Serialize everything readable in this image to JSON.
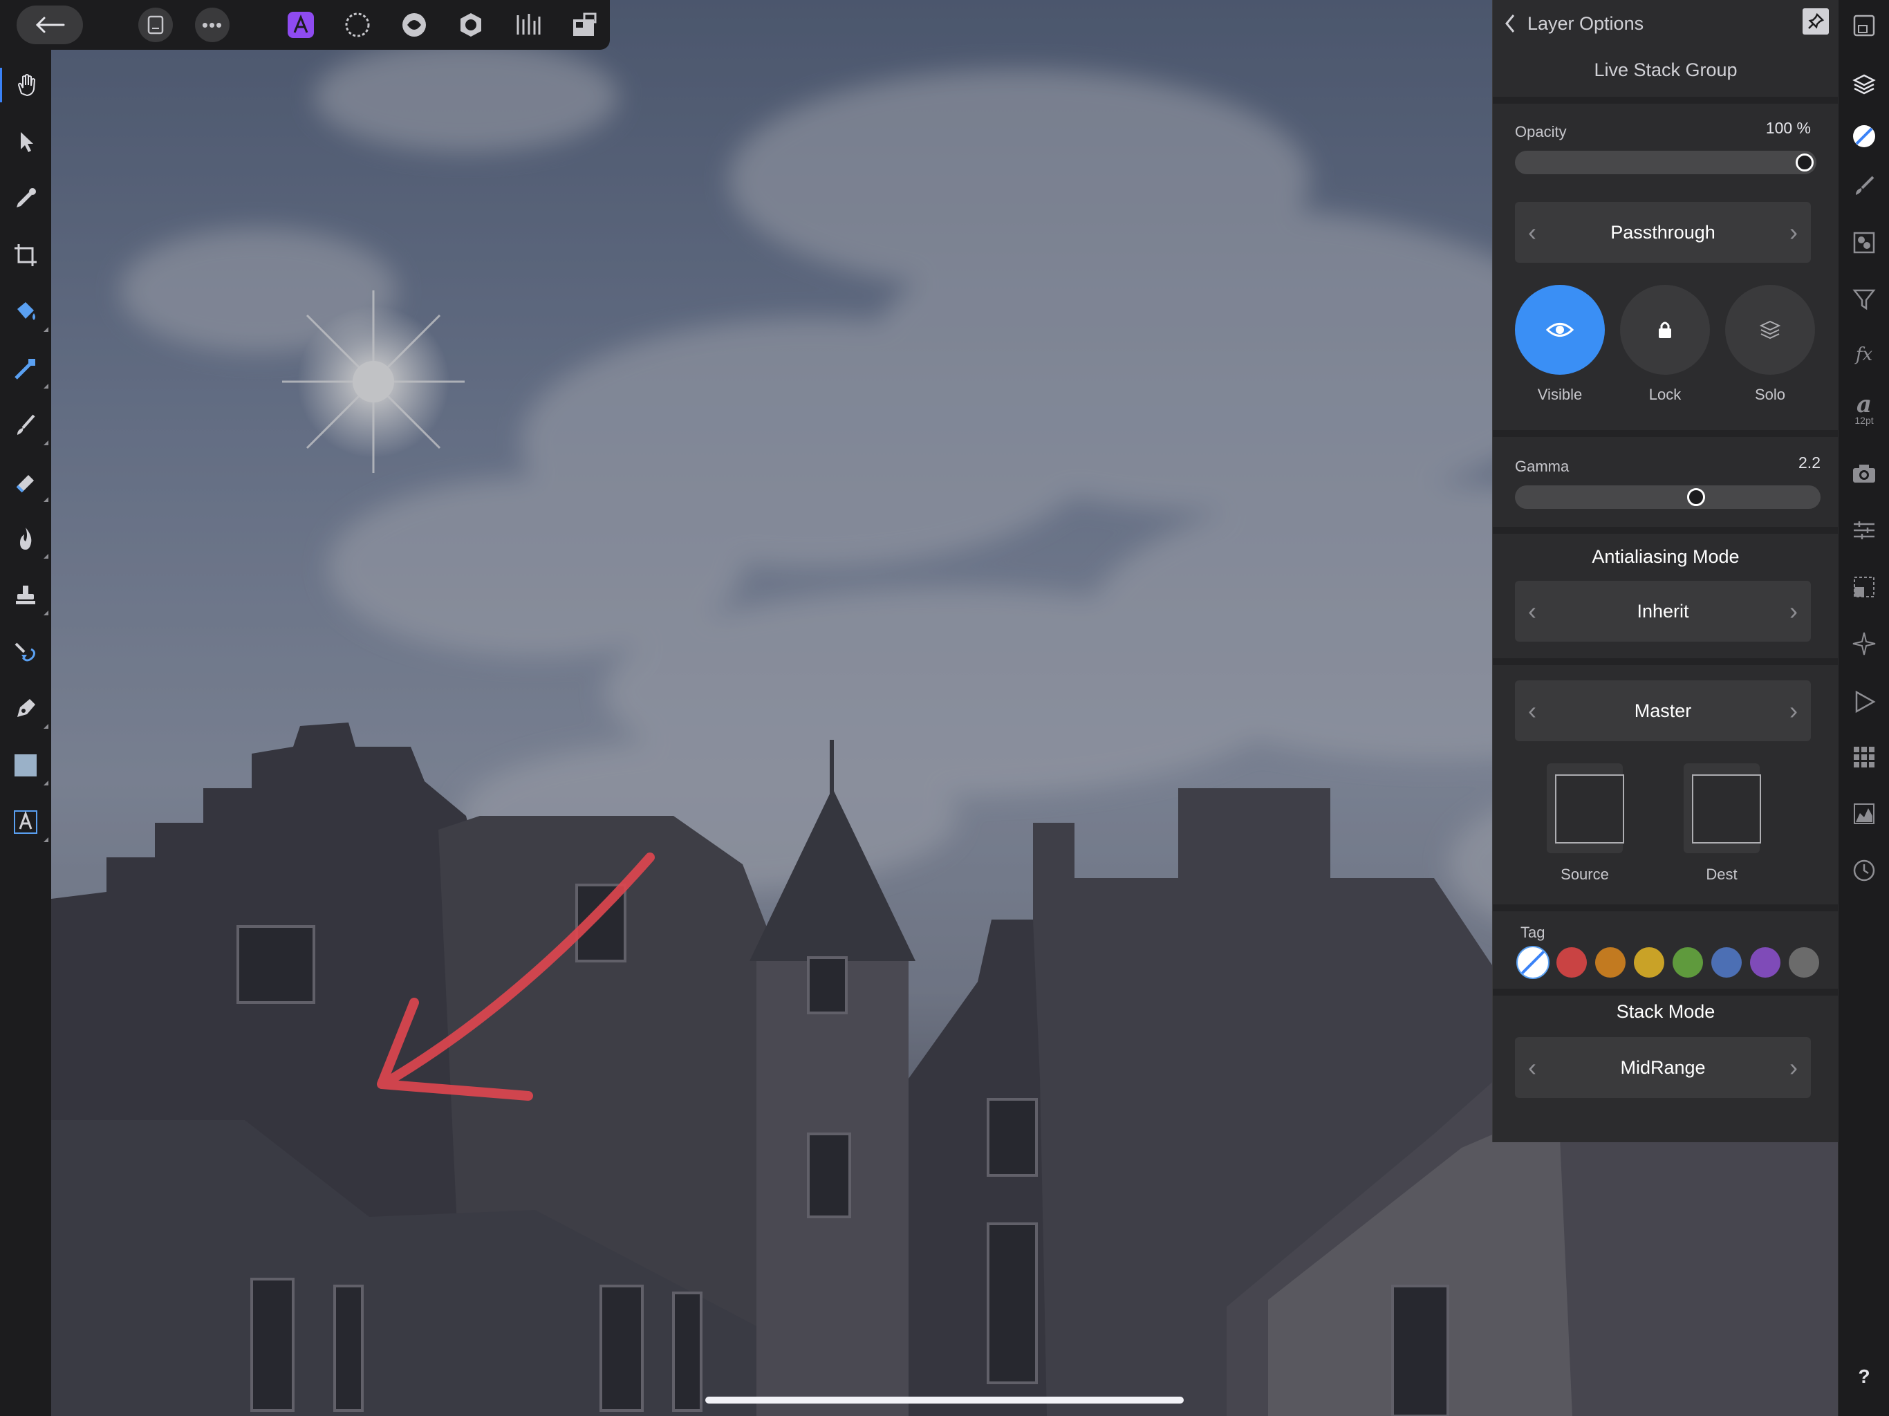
{
  "panel": {
    "back_title": "Layer Options",
    "layer_name": "Live Stack Group",
    "opacity_label": "Opacity",
    "opacity_value": "100 %",
    "opacity_level": 1.0,
    "blend_mode": "Passthrough",
    "visible_label": "Visible",
    "lock_label": "Lock",
    "solo_label": "Solo",
    "gamma_label": "Gamma",
    "gamma_value": "2.2",
    "gamma_level": 0.6,
    "antialiasing_heading": "Antialiasing Mode",
    "antialiasing_value": "Inherit",
    "channel_value": "Master",
    "source_label": "Source",
    "dest_label": "Dest",
    "tag_label": "Tag",
    "tag_colors": [
      "#c94343",
      "#c27a20",
      "#c9a227",
      "#5f9a3d",
      "#4c6fb4",
      "#7f4bb8",
      "#6b6b6b"
    ],
    "stack_mode_heading": "Stack Mode",
    "stack_mode_value": "MidRange"
  },
  "studio": {
    "text_size": "12pt",
    "help": "?"
  },
  "colors": {
    "accent": "#3a82f7",
    "visible_active": "#3a8ff5",
    "arrow_annotation": "#e0464f",
    "persona_active": "#8e4bf0"
  }
}
